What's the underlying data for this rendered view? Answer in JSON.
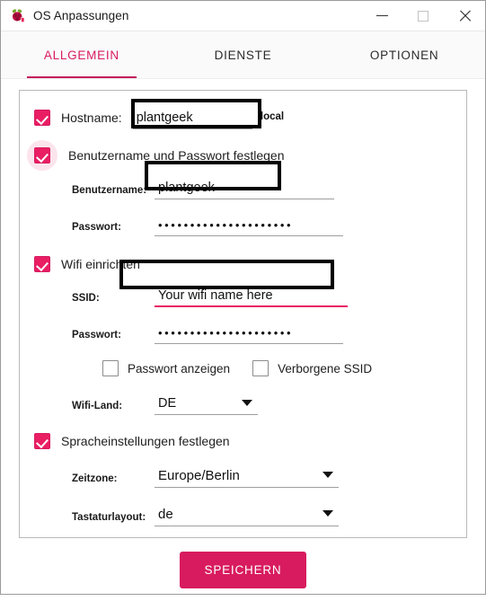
{
  "window": {
    "title": "OS Anpassungen",
    "icon": "raspberry-pi-icon",
    "controls": {
      "minimize": "—",
      "maximize": "□",
      "close": "✕"
    }
  },
  "tabs": [
    {
      "label": "ALLGEMEIN",
      "active": true
    },
    {
      "label": "DIENSTE",
      "active": false
    },
    {
      "label": "OPTIONEN",
      "active": false
    }
  ],
  "form": {
    "hostname": {
      "checkbox_label": "Hostname:",
      "value": "plantgeek",
      "suffix": ".local",
      "checked": true
    },
    "user": {
      "checkbox_label": "Benutzername und Passwort festlegen",
      "checked": true,
      "username_label": "Benutzername:",
      "username_value": "plantgeek",
      "password_label": "Passwort:",
      "password_value": "•••••••••••••••••••••"
    },
    "wifi": {
      "checkbox_label": "Wifi einrichten",
      "checked": true,
      "ssid_label": "SSID:",
      "ssid_value": "Your wifi name here",
      "password_label": "Passwort:",
      "password_value": "•••••••••••••••••••••",
      "show_password_label": "Passwort anzeigen",
      "show_password_checked": false,
      "hidden_ssid_label": "Verborgene SSID",
      "hidden_ssid_checked": false,
      "country_label": "Wifi-Land:",
      "country_value": "DE"
    },
    "locale": {
      "checkbox_label": "Spracheinstellungen festlegen",
      "checked": true,
      "timezone_label": "Zeitzone:",
      "timezone_value": "Europe/Berlin",
      "keyboard_label": "Tastaturlayout:",
      "keyboard_value": "de"
    }
  },
  "footer": {
    "save_label": "SPEICHERN"
  },
  "colors": {
    "accent": "#d81b60",
    "accent_button": "#d81b5e",
    "focus_halo": "#fce4ec",
    "highlight_box": "#000000"
  }
}
